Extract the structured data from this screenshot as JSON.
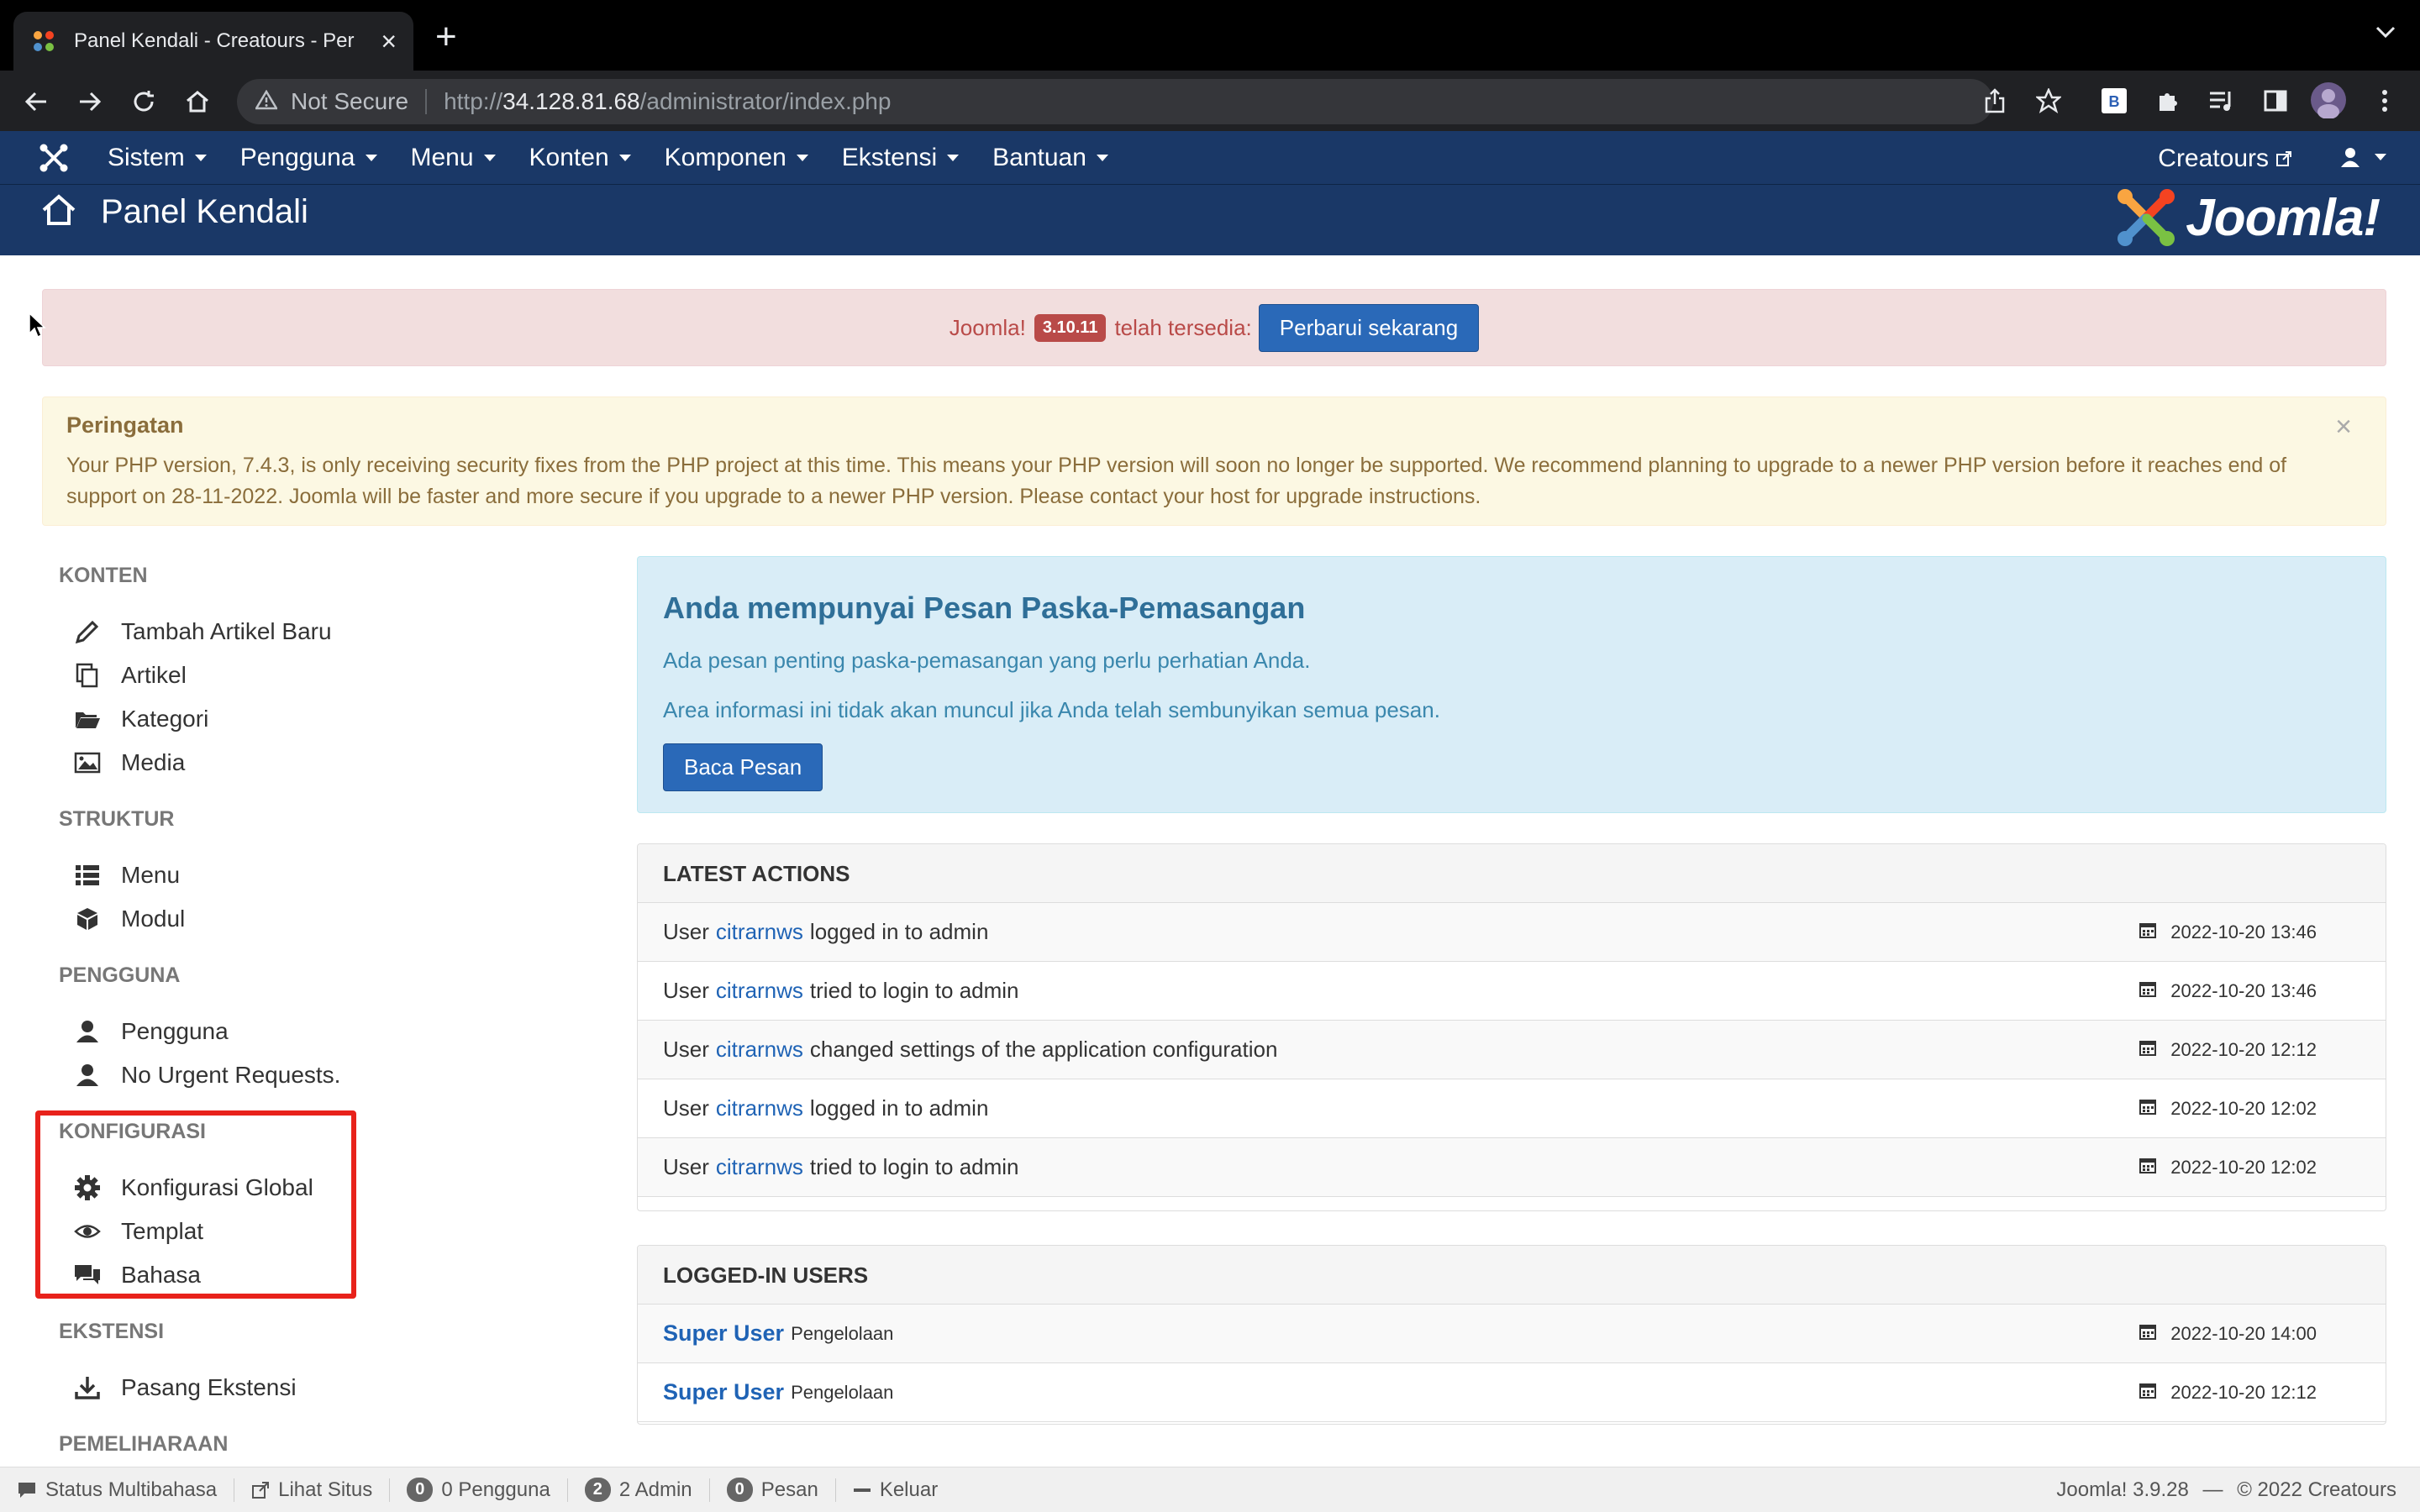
{
  "browser": {
    "tab_title": "Panel Kendali - Creatours - Per",
    "not_secure": "Not Secure",
    "url_prefix": "http://",
    "url_host": "34.128.81.68",
    "url_path": "/administrator/index.php"
  },
  "navbar": {
    "items": [
      "Sistem",
      "Pengguna",
      "Menu",
      "Konten",
      "Komponen",
      "Ekstensi",
      "Bantuan"
    ],
    "site_name": "Creatours"
  },
  "header": {
    "title": "Panel Kendali",
    "logo_text": "Joomla!"
  },
  "update_alert": {
    "prefix": "Joomla!",
    "version": "3.10.11",
    "suffix": "telah tersedia:",
    "button": "Perbarui sekarang"
  },
  "warning": {
    "heading": "Peringatan",
    "text": "Your PHP version, 7.4.3, is only receiving security fixes from the PHP project at this time. This means your PHP version will soon no longer be supported. We recommend planning to upgrade to a newer PHP version before it reaches end of support on 28-11-2022. Joomla will be faster and more secure if you upgrade to a newer PHP version. Please contact your host for upgrade instructions.",
    "close": "×"
  },
  "sidebar": {
    "konten": {
      "title": "KONTEN",
      "items": [
        "Tambah Artikel Baru",
        "Artikel",
        "Kategori",
        "Media"
      ]
    },
    "struktur": {
      "title": "STRUKTUR",
      "items": [
        "Menu",
        "Modul"
      ]
    },
    "pengguna": {
      "title": "PENGGUNA",
      "items": [
        "Pengguna",
        "No Urgent Requests."
      ]
    },
    "konfigurasi": {
      "title": "KONFIGURASI",
      "items": [
        "Konfigurasi Global",
        "Templat",
        "Bahasa"
      ]
    },
    "ekstensi": {
      "title": "EKSTENSI",
      "items": [
        "Pasang Ekstensi"
      ]
    },
    "pemeliharaan": {
      "title": "PEMELIHARAAN"
    }
  },
  "postinstall": {
    "heading": "Anda mempunyai Pesan Paska-Pemasangan",
    "line1": "Ada pesan penting paska-pemasangan yang perlu perhatian Anda.",
    "line2": "Area informasi ini tidak akan muncul jika Anda telah sembunyikan semua pesan.",
    "button": "Baca Pesan"
  },
  "latest_actions": {
    "title": "LATEST ACTIONS",
    "rows": [
      {
        "pre": "User",
        "user": "citrarnws",
        "action": "logged in to admin",
        "date": "2022-10-20 13:46"
      },
      {
        "pre": "User",
        "user": "citrarnws",
        "action": "tried to login to admin",
        "date": "2022-10-20 13:46"
      },
      {
        "pre": "User",
        "user": "citrarnws",
        "action": "changed settings of the application configuration",
        "date": "2022-10-20 12:12"
      },
      {
        "pre": "User",
        "user": "citrarnws",
        "action": "logged in to admin",
        "date": "2022-10-20 12:02"
      },
      {
        "pre": "User",
        "user": "citrarnws",
        "action": "tried to login to admin",
        "date": "2022-10-20 12:02"
      }
    ]
  },
  "logged_in": {
    "title": "LOGGED-IN USERS",
    "rows": [
      {
        "name": "Super User",
        "role": "Pengelolaan",
        "date": "2022-10-20 14:00"
      },
      {
        "name": "Super User",
        "role": "Pengelolaan",
        "date": "2022-10-20 12:12"
      }
    ]
  },
  "statusbar": {
    "multilang": "Status Multibahasa",
    "view_site": "Lihat Situs",
    "visitors_count": "0",
    "visitors_label": "0 Pengguna",
    "admins_count": "2",
    "admins_label": "2 Admin",
    "messages_count": "0",
    "messages_label": "Pesan",
    "logout": "Keluar",
    "version": "Joomla! 3.9.28",
    "dash": "—",
    "copyright": "© 2022 Creatours"
  },
  "colors": {
    "navbar": "#1a3867",
    "highlight": "#e8221b",
    "primary_button": "#2a69b8"
  }
}
